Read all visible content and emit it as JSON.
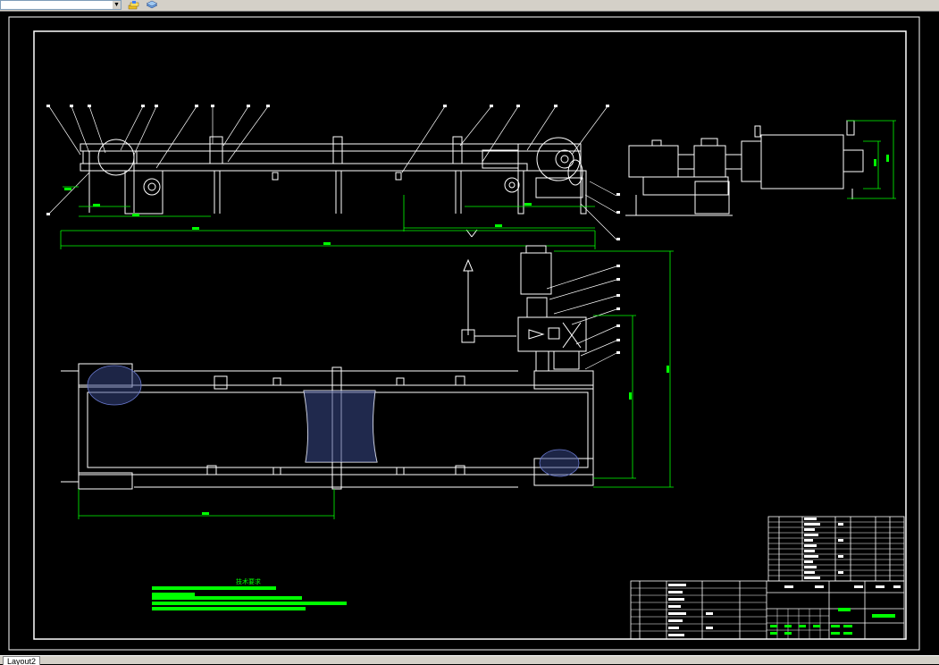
{
  "toolbar": {
    "layer_combo_value": "",
    "icons": [
      "layer-manager-icon",
      "layer-states-icon"
    ]
  },
  "drawing": {
    "tech_requirements_title": "技术要求",
    "view_marker": "Y",
    "colors": {
      "background": "#000000",
      "linework": "#ffffff",
      "dimensions": "#00ff00",
      "section_hatch": "#3a4a8c",
      "tech_text": "#00ff00"
    }
  },
  "layout_tab": {
    "label": "Layout2"
  }
}
